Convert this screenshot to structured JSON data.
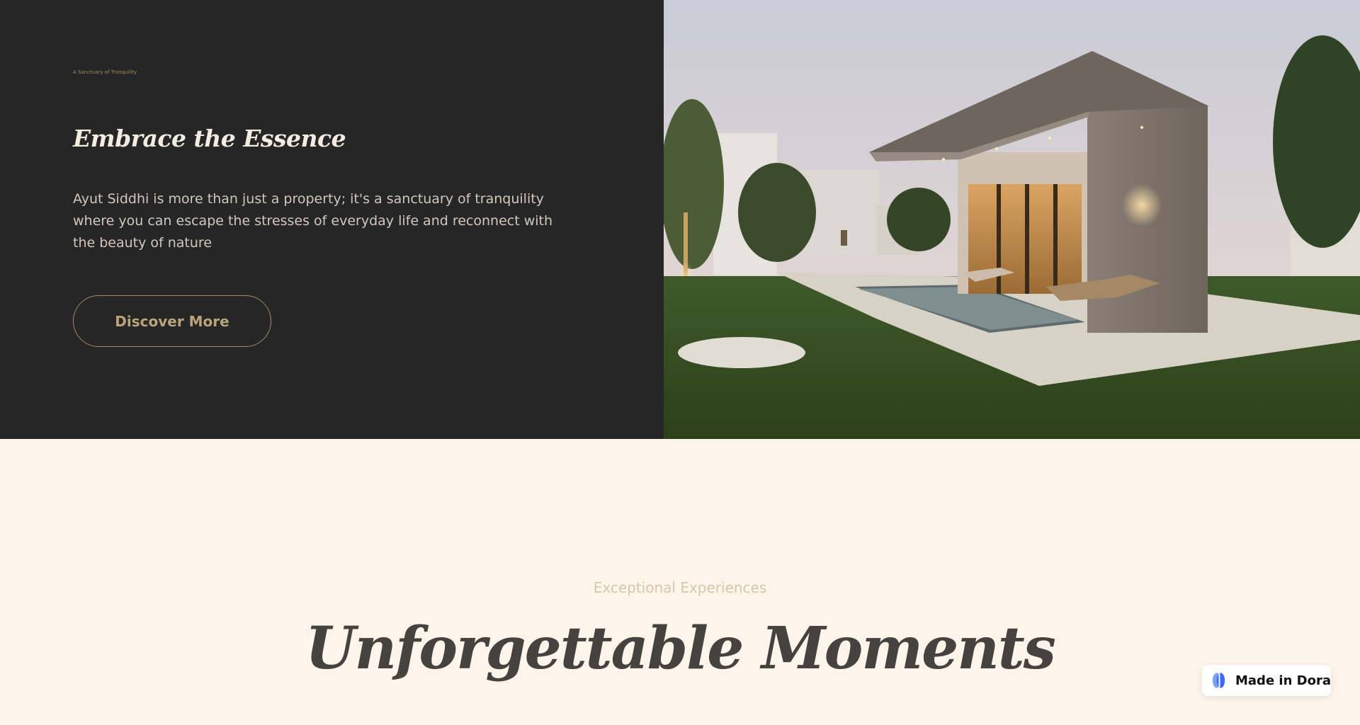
{
  "hero": {
    "eyebrow": "A Sanctuary of Tranquility",
    "title": "Embrace the Essence",
    "description": "Ayut Siddhi is more than just a property; it's a sanctuary of tranquility where you can escape the stresses of everyday life and reconnect with the beauty of nature",
    "cta_label": "Discover More",
    "image_icon": "villa-pool-photo"
  },
  "moments": {
    "eyebrow": "Exceptional Experiences",
    "title": "Unforgettable Moments"
  },
  "badge": {
    "label": "Made in Dora",
    "icon": "dora-logo-icon"
  },
  "colors": {
    "dark_panel": "#262626",
    "accent_gold": "#a08a63",
    "cream_background": "#fdf5ea",
    "heading_dark": "#454240",
    "dora_blue": "#3b6cf6"
  }
}
